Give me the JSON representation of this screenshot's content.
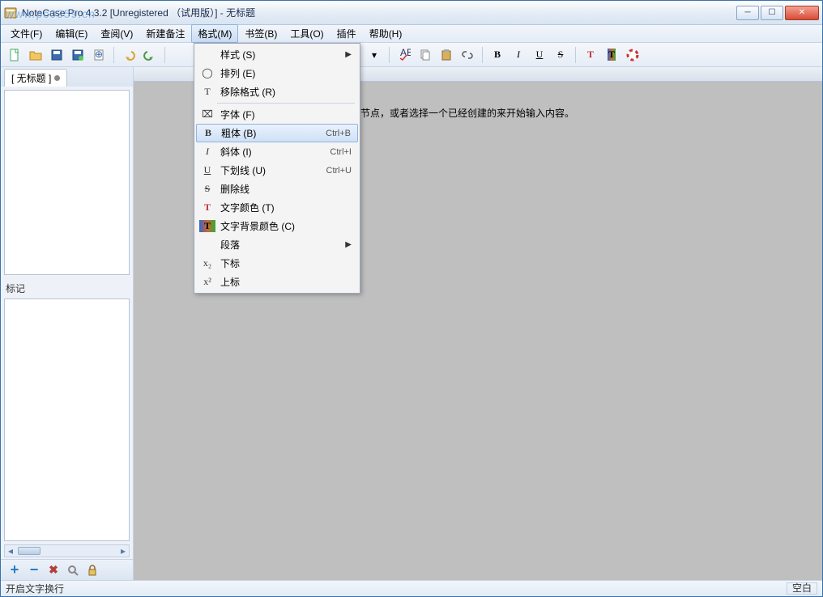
{
  "window": {
    "title": "NoteCase Pro 4.3.2 [Unregistered （试用版）] - 无标题"
  },
  "menubar": {
    "items": [
      {
        "label": "文件(F)"
      },
      {
        "label": "编辑(E)"
      },
      {
        "label": "查阅(V)"
      },
      {
        "label": "新建备注"
      },
      {
        "label": "格式(M)"
      },
      {
        "label": "书签(B)"
      },
      {
        "label": "工具(O)"
      },
      {
        "label": "插件"
      },
      {
        "label": "帮助(H)"
      }
    ],
    "active_index": 4
  },
  "tab": {
    "label": "[ 无标题 ]"
  },
  "left": {
    "tag_label": "标记"
  },
  "editor": {
    "placeholder_text": "节点，或者选择一个已经创建的来开始输入内容。"
  },
  "statusbar": {
    "left": "开启文字换行",
    "right": "空白"
  },
  "dropdown": {
    "items": [
      {
        "icon": "",
        "label": "样式 (S)",
        "shortcut": "",
        "submenu": true
      },
      {
        "icon": "◯",
        "label": "排列 (E)",
        "shortcut": ""
      },
      {
        "icon": "T",
        "label": "移除格式 (R)",
        "shortcut": ""
      },
      {
        "sep": true
      },
      {
        "icon": "⌧",
        "label": "字体 (F)",
        "shortcut": ""
      },
      {
        "icon": "B",
        "label": "粗体 (B)",
        "shortcut": "Ctrl+B",
        "selected": true,
        "bold": true
      },
      {
        "icon": "I",
        "label": "斜体 (I)",
        "shortcut": "Ctrl+I",
        "italic": true
      },
      {
        "icon": "U",
        "label": "下划线 (U)",
        "shortcut": "Ctrl+U",
        "underline": true
      },
      {
        "icon": "S",
        "label": "删除线",
        "shortcut": "",
        "strike": true
      },
      {
        "icon": "T",
        "label": "文字颜色 (T)",
        "shortcut": "",
        "color": "#c03030"
      },
      {
        "icon": "T",
        "label": "文字背景颜色 (C)",
        "shortcut": "",
        "tbg": true
      },
      {
        "icon": "",
        "label": "段落",
        "shortcut": "",
        "submenu": true
      },
      {
        "icon": "x₂",
        "label": "下标",
        "shortcut": ""
      },
      {
        "icon": "x²",
        "label": "上标",
        "shortcut": ""
      }
    ]
  },
  "toolbar_hint_icons": [
    "new-doc",
    "open",
    "save",
    "save-floppy",
    "print",
    "divider",
    "undo",
    "redo",
    "divider",
    "nav-back",
    "nav-fwd",
    "divider",
    "find",
    "replace",
    "copy",
    "paste",
    "divider",
    "bold",
    "italic",
    "underline",
    "strike",
    "divider",
    "text-color",
    "text-bg",
    "help-ring"
  ],
  "watermark": {
    "line1": "",
    "line2": "www.pc0359.cn"
  }
}
